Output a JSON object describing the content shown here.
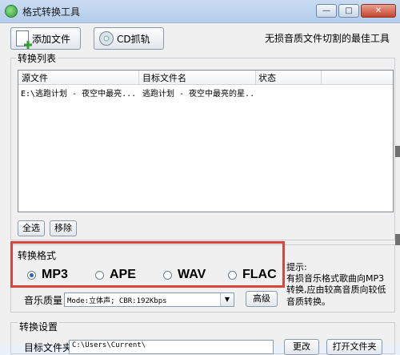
{
  "window": {
    "title": "格式转换工具",
    "min_label": "—",
    "max_label": "□",
    "close_label": "✕"
  },
  "toolbar": {
    "add_label": "添加文件",
    "cd_label": "CD抓轨",
    "slogan": "无损音质文件切割的最佳工具",
    "add_icon": "add-file-icon",
    "cd_icon": "cd-icon"
  },
  "list": {
    "group_label": "转换列表",
    "columns": [
      "源文件",
      "目标文件名",
      "状态"
    ],
    "rows": [
      {
        "source": "E:\\逃跑计划 - 夜空中最亮...",
        "target": "逃跑计划 - 夜空中最亮的星...",
        "status": ""
      }
    ]
  },
  "list_buttons": {
    "select_all": "全选",
    "remove": "移除"
  },
  "format": {
    "group_label": "转换格式",
    "options": [
      "MP3",
      "APE",
      "WAV",
      "FLAC"
    ],
    "selected": "MP3",
    "highlight_color": "#d9443f"
  },
  "quality": {
    "label": "音乐质量",
    "value": "Mode:立体声; CBR:192Kbps",
    "advanced_label": "高级"
  },
  "tip": {
    "line1": "提示:",
    "line2": "有损音乐格式歌曲向MP3",
    "line3": "转换,应由较高音质向较低",
    "line4": "音质转换。"
  },
  "settings": {
    "group_label": "转换设置",
    "output_label": "目标文件夹",
    "output_value": "C:\\Users\\Current\\",
    "change_label": "更改",
    "open_label": "打开文件夹"
  }
}
